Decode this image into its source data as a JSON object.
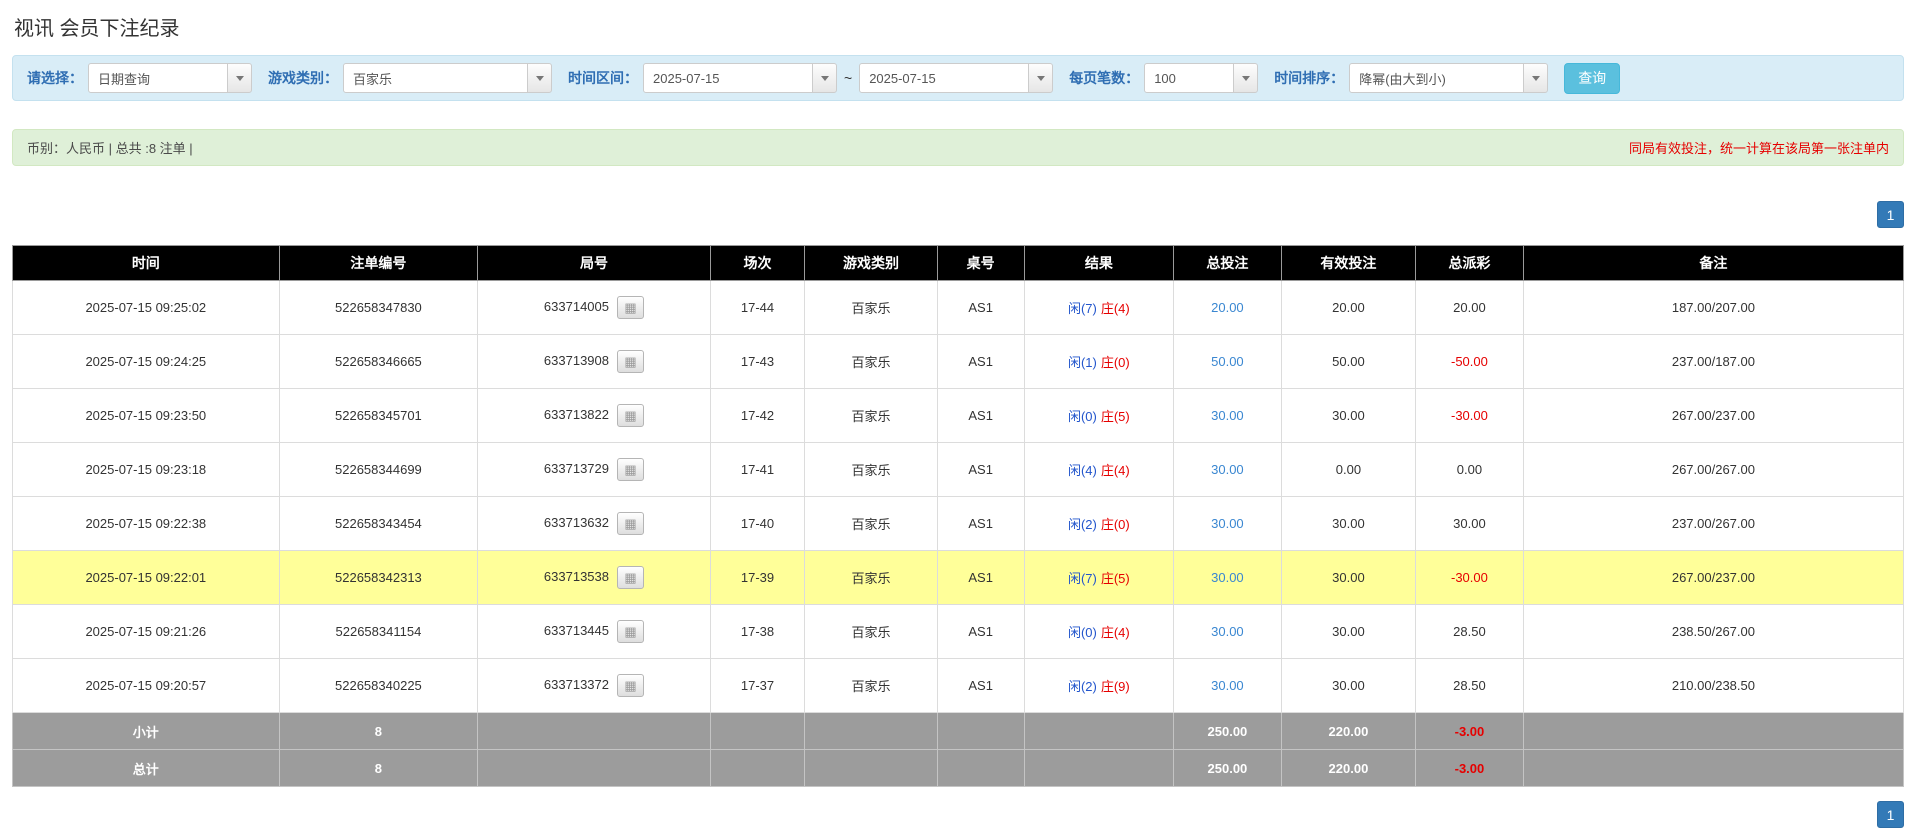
{
  "page": {
    "title": "视讯 会员下注纪录"
  },
  "icons": {
    "chevron": "▼",
    "round_detail": "▦"
  },
  "filters": {
    "select_label": "请选择：",
    "select_value": "日期查询",
    "game_label": "游戏类别：",
    "game_value": "百家乐",
    "range_label": "时间区间：",
    "date_from": "2025-07-15",
    "range_separator": "~",
    "date_to": "2025-07-15",
    "per_page_label": "每页笔数：",
    "per_page_value": "100",
    "sort_label": "时间排序：",
    "sort_value": "降幂(由大到小)",
    "query_button": "查询"
  },
  "info_bar": {
    "summary": "币别：人民币 | 总共 :8 注单 |",
    "notice": "同局有效投注，统一计算在该局第一张注单内"
  },
  "pagination": {
    "page": "1"
  },
  "table": {
    "headers": [
      "时间",
      "注单编号",
      "局号",
      "场次",
      "游戏类别",
      "桌号",
      "结果",
      "总投注",
      "有效投注",
      "总派彩",
      "备注"
    ],
    "rows": [
      {
        "time": "2025-07-15 09:25:02",
        "bet_id": "522658347830",
        "round_no": "633714005",
        "session": "17-44",
        "game": "百家乐",
        "table_no": "AS1",
        "result_player": "闲(7)",
        "result_banker": "庄(4)",
        "total_bet": "20.00",
        "valid_bet": "20.00",
        "payout": "20.00",
        "note": "187.00/207.00",
        "highlight": false
      },
      {
        "time": "2025-07-15 09:24:25",
        "bet_id": "522658346665",
        "round_no": "633713908",
        "session": "17-43",
        "game": "百家乐",
        "table_no": "AS1",
        "result_player": "闲(1)",
        "result_banker": "庄(0)",
        "total_bet": "50.00",
        "valid_bet": "50.00",
        "payout": "-50.00",
        "note": "237.00/187.00",
        "highlight": false
      },
      {
        "time": "2025-07-15 09:23:50",
        "bet_id": "522658345701",
        "round_no": "633713822",
        "session": "17-42",
        "game": "百家乐",
        "table_no": "AS1",
        "result_player": "闲(0)",
        "result_banker": "庄(5)",
        "total_bet": "30.00",
        "valid_bet": "30.00",
        "payout": "-30.00",
        "note": "267.00/237.00",
        "highlight": false
      },
      {
        "time": "2025-07-15 09:23:18",
        "bet_id": "522658344699",
        "round_no": "633713729",
        "session": "17-41",
        "game": "百家乐",
        "table_no": "AS1",
        "result_player": "闲(4)",
        "result_banker": "庄(4)",
        "total_bet": "30.00",
        "valid_bet": "0.00",
        "payout": "0.00",
        "note": "267.00/267.00",
        "highlight": false
      },
      {
        "time": "2025-07-15 09:22:38",
        "bet_id": "522658343454",
        "round_no": "633713632",
        "session": "17-40",
        "game": "百家乐",
        "table_no": "AS1",
        "result_player": "闲(2)",
        "result_banker": "庄(0)",
        "total_bet": "30.00",
        "valid_bet": "30.00",
        "payout": "30.00",
        "note": "237.00/267.00",
        "highlight": false
      },
      {
        "time": "2025-07-15 09:22:01",
        "bet_id": "522658342313",
        "round_no": "633713538",
        "session": "17-39",
        "game": "百家乐",
        "table_no": "AS1",
        "result_player": "闲(7)",
        "result_banker": "庄(5)",
        "total_bet": "30.00",
        "valid_bet": "30.00",
        "payout": "-30.00",
        "note": "267.00/237.00",
        "highlight": true
      },
      {
        "time": "2025-07-15 09:21:26",
        "bet_id": "522658341154",
        "round_no": "633713445",
        "session": "17-38",
        "game": "百家乐",
        "table_no": "AS1",
        "result_player": "闲(0)",
        "result_banker": "庄(4)",
        "total_bet": "30.00",
        "valid_bet": "30.00",
        "payout": "28.50",
        "note": "238.50/267.00",
        "highlight": false
      },
      {
        "time": "2025-07-15 09:20:57",
        "bet_id": "522658340225",
        "round_no": "633713372",
        "session": "17-37",
        "game": "百家乐",
        "table_no": "AS1",
        "result_player": "闲(2)",
        "result_banker": "庄(9)",
        "total_bet": "30.00",
        "valid_bet": "30.00",
        "payout": "28.50",
        "note": "210.00/238.50",
        "highlight": false
      }
    ],
    "subtotal": {
      "label": "小计",
      "count": "8",
      "total_bet": "250.00",
      "valid_bet": "220.00",
      "payout": "-3.00"
    },
    "total": {
      "label": "总计",
      "count": "8",
      "total_bet": "250.00",
      "valid_bet": "220.00",
      "payout": "-3.00"
    }
  }
}
